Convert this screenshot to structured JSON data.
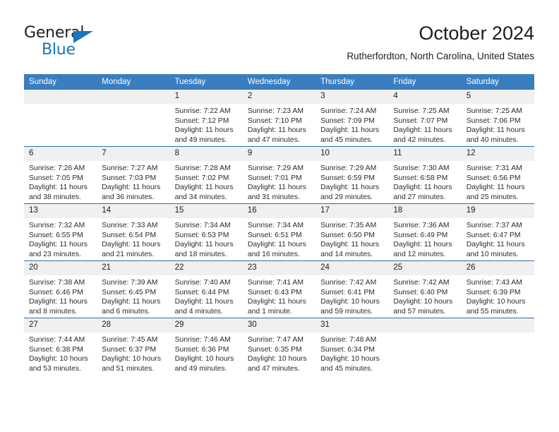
{
  "brand": {
    "name_top": "General",
    "name_bottom": "Blue",
    "accent_color": "#1b75bb"
  },
  "header": {
    "month_title": "October 2024",
    "location": "Rutherfordton, North Carolina, United States"
  },
  "calendar": {
    "header_bg": "#3a7ec0",
    "daynum_bg": "#f0f0f0",
    "border_color": "#2f6fb0",
    "weekday_headers": [
      "Sunday",
      "Monday",
      "Tuesday",
      "Wednesday",
      "Thursday",
      "Friday",
      "Saturday"
    ],
    "weeks": [
      [
        {
          "day": "",
          "sunrise": "",
          "sunset": "",
          "daylight_1": "",
          "daylight_2": ""
        },
        {
          "day": "",
          "sunrise": "",
          "sunset": "",
          "daylight_1": "",
          "daylight_2": ""
        },
        {
          "day": "1",
          "sunrise": "Sunrise: 7:22 AM",
          "sunset": "Sunset: 7:12 PM",
          "daylight_1": "Daylight: 11 hours",
          "daylight_2": "and 49 minutes."
        },
        {
          "day": "2",
          "sunrise": "Sunrise: 7:23 AM",
          "sunset": "Sunset: 7:10 PM",
          "daylight_1": "Daylight: 11 hours",
          "daylight_2": "and 47 minutes."
        },
        {
          "day": "3",
          "sunrise": "Sunrise: 7:24 AM",
          "sunset": "Sunset: 7:09 PM",
          "daylight_1": "Daylight: 11 hours",
          "daylight_2": "and 45 minutes."
        },
        {
          "day": "4",
          "sunrise": "Sunrise: 7:25 AM",
          "sunset": "Sunset: 7:07 PM",
          "daylight_1": "Daylight: 11 hours",
          "daylight_2": "and 42 minutes."
        },
        {
          "day": "5",
          "sunrise": "Sunrise: 7:25 AM",
          "sunset": "Sunset: 7:06 PM",
          "daylight_1": "Daylight: 11 hours",
          "daylight_2": "and 40 minutes."
        }
      ],
      [
        {
          "day": "6",
          "sunrise": "Sunrise: 7:26 AM",
          "sunset": "Sunset: 7:05 PM",
          "daylight_1": "Daylight: 11 hours",
          "daylight_2": "and 38 minutes."
        },
        {
          "day": "7",
          "sunrise": "Sunrise: 7:27 AM",
          "sunset": "Sunset: 7:03 PM",
          "daylight_1": "Daylight: 11 hours",
          "daylight_2": "and 36 minutes."
        },
        {
          "day": "8",
          "sunrise": "Sunrise: 7:28 AM",
          "sunset": "Sunset: 7:02 PM",
          "daylight_1": "Daylight: 11 hours",
          "daylight_2": "and 34 minutes."
        },
        {
          "day": "9",
          "sunrise": "Sunrise: 7:29 AM",
          "sunset": "Sunset: 7:01 PM",
          "daylight_1": "Daylight: 11 hours",
          "daylight_2": "and 31 minutes."
        },
        {
          "day": "10",
          "sunrise": "Sunrise: 7:29 AM",
          "sunset": "Sunset: 6:59 PM",
          "daylight_1": "Daylight: 11 hours",
          "daylight_2": "and 29 minutes."
        },
        {
          "day": "11",
          "sunrise": "Sunrise: 7:30 AM",
          "sunset": "Sunset: 6:58 PM",
          "daylight_1": "Daylight: 11 hours",
          "daylight_2": "and 27 minutes."
        },
        {
          "day": "12",
          "sunrise": "Sunrise: 7:31 AM",
          "sunset": "Sunset: 6:56 PM",
          "daylight_1": "Daylight: 11 hours",
          "daylight_2": "and 25 minutes."
        }
      ],
      [
        {
          "day": "13",
          "sunrise": "Sunrise: 7:32 AM",
          "sunset": "Sunset: 6:55 PM",
          "daylight_1": "Daylight: 11 hours",
          "daylight_2": "and 23 minutes."
        },
        {
          "day": "14",
          "sunrise": "Sunrise: 7:33 AM",
          "sunset": "Sunset: 6:54 PM",
          "daylight_1": "Daylight: 11 hours",
          "daylight_2": "and 21 minutes."
        },
        {
          "day": "15",
          "sunrise": "Sunrise: 7:34 AM",
          "sunset": "Sunset: 6:53 PM",
          "daylight_1": "Daylight: 11 hours",
          "daylight_2": "and 18 minutes."
        },
        {
          "day": "16",
          "sunrise": "Sunrise: 7:34 AM",
          "sunset": "Sunset: 6:51 PM",
          "daylight_1": "Daylight: 11 hours",
          "daylight_2": "and 16 minutes."
        },
        {
          "day": "17",
          "sunrise": "Sunrise: 7:35 AM",
          "sunset": "Sunset: 6:50 PM",
          "daylight_1": "Daylight: 11 hours",
          "daylight_2": "and 14 minutes."
        },
        {
          "day": "18",
          "sunrise": "Sunrise: 7:36 AM",
          "sunset": "Sunset: 6:49 PM",
          "daylight_1": "Daylight: 11 hours",
          "daylight_2": "and 12 minutes."
        },
        {
          "day": "19",
          "sunrise": "Sunrise: 7:37 AM",
          "sunset": "Sunset: 6:47 PM",
          "daylight_1": "Daylight: 11 hours",
          "daylight_2": "and 10 minutes."
        }
      ],
      [
        {
          "day": "20",
          "sunrise": "Sunrise: 7:38 AM",
          "sunset": "Sunset: 6:46 PM",
          "daylight_1": "Daylight: 11 hours",
          "daylight_2": "and 8 minutes."
        },
        {
          "day": "21",
          "sunrise": "Sunrise: 7:39 AM",
          "sunset": "Sunset: 6:45 PM",
          "daylight_1": "Daylight: 11 hours",
          "daylight_2": "and 6 minutes."
        },
        {
          "day": "22",
          "sunrise": "Sunrise: 7:40 AM",
          "sunset": "Sunset: 6:44 PM",
          "daylight_1": "Daylight: 11 hours",
          "daylight_2": "and 4 minutes."
        },
        {
          "day": "23",
          "sunrise": "Sunrise: 7:41 AM",
          "sunset": "Sunset: 6:43 PM",
          "daylight_1": "Daylight: 11 hours",
          "daylight_2": "and 1 minute."
        },
        {
          "day": "24",
          "sunrise": "Sunrise: 7:42 AM",
          "sunset": "Sunset: 6:41 PM",
          "daylight_1": "Daylight: 10 hours",
          "daylight_2": "and 59 minutes."
        },
        {
          "day": "25",
          "sunrise": "Sunrise: 7:42 AM",
          "sunset": "Sunset: 6:40 PM",
          "daylight_1": "Daylight: 10 hours",
          "daylight_2": "and 57 minutes."
        },
        {
          "day": "26",
          "sunrise": "Sunrise: 7:43 AM",
          "sunset": "Sunset: 6:39 PM",
          "daylight_1": "Daylight: 10 hours",
          "daylight_2": "and 55 minutes."
        }
      ],
      [
        {
          "day": "27",
          "sunrise": "Sunrise: 7:44 AM",
          "sunset": "Sunset: 6:38 PM",
          "daylight_1": "Daylight: 10 hours",
          "daylight_2": "and 53 minutes."
        },
        {
          "day": "28",
          "sunrise": "Sunrise: 7:45 AM",
          "sunset": "Sunset: 6:37 PM",
          "daylight_1": "Daylight: 10 hours",
          "daylight_2": "and 51 minutes."
        },
        {
          "day": "29",
          "sunrise": "Sunrise: 7:46 AM",
          "sunset": "Sunset: 6:36 PM",
          "daylight_1": "Daylight: 10 hours",
          "daylight_2": "and 49 minutes."
        },
        {
          "day": "30",
          "sunrise": "Sunrise: 7:47 AM",
          "sunset": "Sunset: 6:35 PM",
          "daylight_1": "Daylight: 10 hours",
          "daylight_2": "and 47 minutes."
        },
        {
          "day": "31",
          "sunrise": "Sunrise: 7:48 AM",
          "sunset": "Sunset: 6:34 PM",
          "daylight_1": "Daylight: 10 hours",
          "daylight_2": "and 45 minutes."
        },
        {
          "day": "",
          "sunrise": "",
          "sunset": "",
          "daylight_1": "",
          "daylight_2": ""
        },
        {
          "day": "",
          "sunrise": "",
          "sunset": "",
          "daylight_1": "",
          "daylight_2": ""
        }
      ]
    ]
  }
}
